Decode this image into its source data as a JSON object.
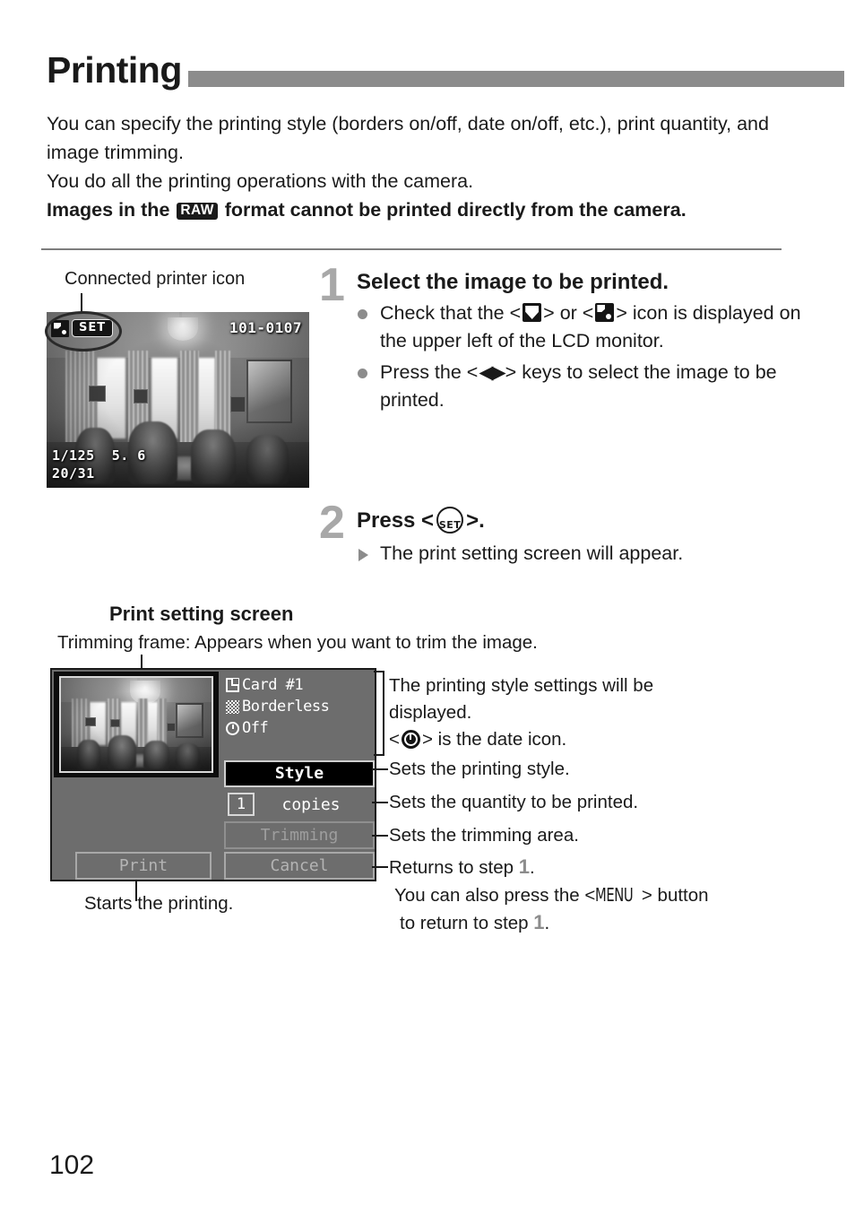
{
  "page": {
    "title": "Printing",
    "number": "102"
  },
  "intro": {
    "line1": "You can specify the printing style (borders on/off, date on/off, etc.), print quantity, and image trimming.",
    "line2": "You do all the printing operations with the camera.",
    "warning_prefix": "Images in the",
    "warning_badge": "RAW",
    "warning_suffix": "format cannot be printed directly from the camera."
  },
  "lcd_caption": "Connected printer icon",
  "lcd_screen": {
    "file_number": "101-0107",
    "shutter_speed": "1/125",
    "aperture": "5. 6",
    "frame_counter": "20/31",
    "set_badge": "SET",
    "printer_icon": "direct-print-icon"
  },
  "steps": [
    {
      "number": "1",
      "heading": "Select the image to be printed.",
      "bullets": [
        {
          "prefix": "Check that the <",
          "icon1": "direct-print-icon",
          "mid": "> or <",
          "icon2": "pictbridge-icon",
          "suffix": "> icon is displayed on the upper left of the LCD monitor."
        },
        {
          "prefix": "Press the <",
          "icon1": "left-right-arrows-icon",
          "suffix": "> keys to select the image to be printed."
        }
      ]
    },
    {
      "number": "2",
      "heading_prefix": "Press <",
      "heading_icon": "SET",
      "heading_suffix": ">.",
      "result": "The print setting screen will appear."
    }
  ],
  "print_setting": {
    "section_title": "Print setting screen",
    "trimming_caption": "Trimming frame: Appears when you want to trim the image.",
    "screen": {
      "card_label": "Card #1",
      "border_label": "Borderless",
      "date_label": "Off",
      "style_button": "Style",
      "copies_qty": "1",
      "copies_label": "copies",
      "trimming_button": "Trimming",
      "print_button": "Print",
      "cancel_button": "Cancel"
    },
    "annotations": {
      "settings_note_line1": "The printing style settings will be",
      "settings_note_line2": "displayed.",
      "date_icon_prefix": "<",
      "date_icon_name": "date-clock-icon",
      "date_icon_suffix": "> is the date icon.",
      "style_note": "Sets the printing style.",
      "copies_note": "Sets the quantity to be printed.",
      "trimming_note": "Sets the trimming area.",
      "cancel_note_prefix": "Returns to step",
      "cancel_note_step": "1",
      "cancel_note_suffix": ".",
      "menu_note_prefix": "You can also press the <",
      "menu_note_button": "MENU",
      "menu_note_mid": "> button",
      "menu_note_line2_prefix": "to return to step",
      "menu_note_line2_step": "1",
      "menu_note_line2_suffix": ".",
      "print_note": "Starts the printing."
    }
  }
}
